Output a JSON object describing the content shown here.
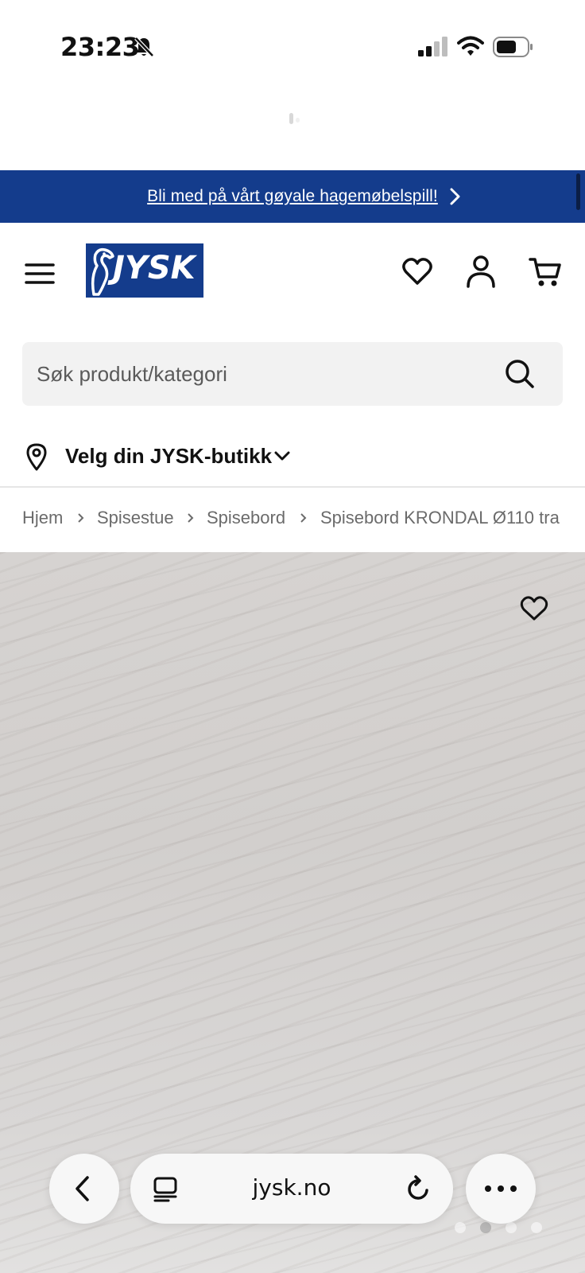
{
  "status_bar": {
    "time": "23:23",
    "icons": [
      "bell-slash-icon",
      "cellular-signal-icon",
      "wifi-icon",
      "battery-icon"
    ]
  },
  "promo_banner": {
    "text": "Bli med på vårt gøyale hagemøbelspill!",
    "background": "#143c8c"
  },
  "header": {
    "logo_text": "JYSK",
    "icons": [
      "menu-icon",
      "wishlist-icon",
      "account-icon",
      "cart-icon"
    ]
  },
  "search": {
    "placeholder": "Søk produkt/kategori"
  },
  "store_picker": {
    "label": "Velg din JYSK-butikk"
  },
  "breadcrumb": {
    "items": [
      "Hjem",
      "Spisestue",
      "Spisebord",
      "Spisebord KRONDAL Ø110 tra"
    ]
  },
  "browser": {
    "url": "jysk.no"
  },
  "colors": {
    "brand_blue": "#143c8c",
    "search_bg": "#f2f2f2",
    "breadcrumb_text": "#6b6b6b"
  }
}
